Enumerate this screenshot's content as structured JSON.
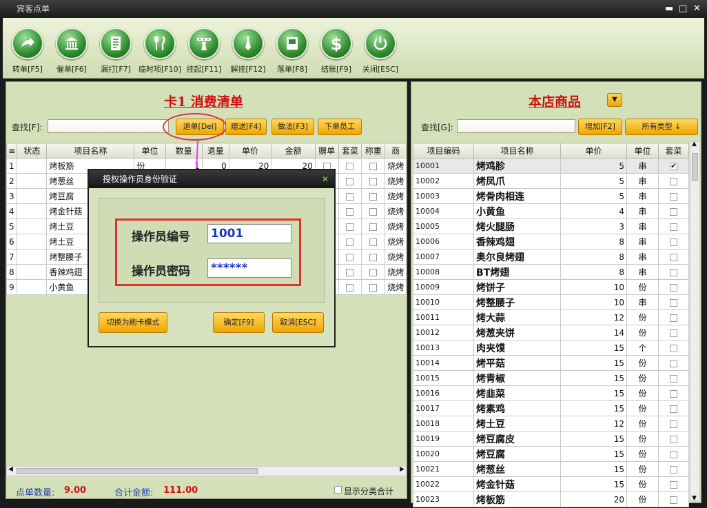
{
  "window": {
    "title": "宾客点单",
    "minimize": "▬",
    "maximize": "□",
    "close": "✕"
  },
  "toolbar": {
    "buttons": [
      {
        "label": "转单[F5]",
        "icon": "arrow-right-icon"
      },
      {
        "label": "催单[F6]",
        "icon": "bank-icon"
      },
      {
        "label": "漏打[F7]",
        "icon": "document-icon"
      },
      {
        "label": "临时项[F10]",
        "icon": "cutlery-icon"
      },
      {
        "label": "挂起[F11]",
        "icon": "waiter-icon"
      },
      {
        "label": "解挂[F12]",
        "icon": "tie-icon"
      },
      {
        "label": "落单[F8]",
        "icon": "book-icon"
      },
      {
        "label": "结账[F9]",
        "icon": "dollar-icon"
      },
      {
        "label": "关闭[ESC]",
        "icon": "power-icon"
      }
    ]
  },
  "left": {
    "title": "卡1  消费清单",
    "find_label": "查找[F]:",
    "find_value": "",
    "buttons": {
      "return": "退单[Del]",
      "gift": "赠送[F4]",
      "method": "做法[F3]",
      "staff": "下单员工"
    },
    "columns": [
      "≡",
      "状态",
      "项目名称",
      "单位",
      "数量",
      "退量",
      "单价",
      "金额",
      "赠单",
      "套菜",
      "称重",
      "商"
    ],
    "rows": [
      {
        "no": "1",
        "status": "",
        "name": "烤板筋",
        "unit": "份",
        "qty": "1",
        "ret": "0",
        "price": "20",
        "amount": "20",
        "cat": "烧烤"
      },
      {
        "no": "2",
        "status": "",
        "name": "烤葱丝",
        "unit": "",
        "qty": "",
        "ret": "",
        "price": "",
        "amount": "",
        "cat": "烧烤"
      },
      {
        "no": "3",
        "status": "",
        "name": "烤豆腐",
        "unit": "",
        "qty": "",
        "ret": "",
        "price": "",
        "amount": "",
        "cat": "烧烤"
      },
      {
        "no": "4",
        "status": "",
        "name": "烤金针菇",
        "unit": "",
        "qty": "",
        "ret": "",
        "price": "",
        "amount": "",
        "cat": "烧烤"
      },
      {
        "no": "5",
        "status": "",
        "name": "烤土豆",
        "unit": "",
        "qty": "",
        "ret": "",
        "price": "",
        "amount": "",
        "cat": "烧烤"
      },
      {
        "no": "6",
        "status": "",
        "name": "烤土豆",
        "unit": "",
        "qty": "",
        "ret": "",
        "price": "",
        "amount": "",
        "cat": "烧烤"
      },
      {
        "no": "7",
        "status": "",
        "name": "烤整腰子",
        "unit": "",
        "qty": "",
        "ret": "",
        "price": "",
        "amount": "",
        "cat": "烧烤"
      },
      {
        "no": "8",
        "status": "",
        "name": "香辣鸡翅",
        "unit": "",
        "qty": "",
        "ret": "",
        "price": "",
        "amount": "",
        "cat": "烧烤"
      },
      {
        "no": "9",
        "status": "",
        "name": "小黄鱼",
        "unit": "",
        "qty": "",
        "ret": "",
        "price": "",
        "amount": "",
        "cat": "烧烤"
      }
    ],
    "footer": {
      "count_label": "点单数量:",
      "count": "9.00",
      "total_label": "合计金额:",
      "total": "111.00",
      "show_cat": "显示分类合计"
    }
  },
  "right": {
    "title": "本店商品",
    "dropdown": "▼",
    "find_label": "查找[G]:",
    "find_value": "",
    "add": "增加[F2]",
    "type": "所有类型 ↓",
    "columns": [
      "项目编码",
      "项目名称",
      "单价",
      "单位",
      "套菜"
    ],
    "rows": [
      {
        "code": "10001",
        "name": "烤鸡胗",
        "price": "5",
        "unit": "串",
        "set": "✔"
      },
      {
        "code": "10002",
        "name": "烤凤爪",
        "price": "5",
        "unit": "串",
        "set": ""
      },
      {
        "code": "10003",
        "name": "烤骨肉相连",
        "price": "5",
        "unit": "串",
        "set": ""
      },
      {
        "code": "10004",
        "name": "小黄鱼",
        "price": "4",
        "unit": "串",
        "set": ""
      },
      {
        "code": "10005",
        "name": "烤火腿肠",
        "price": "3",
        "unit": "串",
        "set": ""
      },
      {
        "code": "10006",
        "name": "香辣鸡翅",
        "price": "8",
        "unit": "串",
        "set": ""
      },
      {
        "code": "10007",
        "name": "奥尔良烤翅",
        "price": "8",
        "unit": "串",
        "set": ""
      },
      {
        "code": "10008",
        "name": "BT烤翅",
        "price": "8",
        "unit": "串",
        "set": ""
      },
      {
        "code": "10009",
        "name": "烤饼子",
        "price": "10",
        "unit": "份",
        "set": ""
      },
      {
        "code": "10010",
        "name": "烤整腰子",
        "price": "10",
        "unit": "串",
        "set": ""
      },
      {
        "code": "10011",
        "name": "烤大蒜",
        "price": "12",
        "unit": "份",
        "set": ""
      },
      {
        "code": "10012",
        "name": "烤葱夹饼",
        "price": "14",
        "unit": "份",
        "set": ""
      },
      {
        "code": "10013",
        "name": "肉夹馍",
        "price": "15",
        "unit": "个",
        "set": ""
      },
      {
        "code": "10014",
        "name": "烤平菇",
        "price": "15",
        "unit": "份",
        "set": ""
      },
      {
        "code": "10015",
        "name": "烤青椒",
        "price": "15",
        "unit": "份",
        "set": ""
      },
      {
        "code": "10016",
        "name": "烤韭菜",
        "price": "15",
        "unit": "份",
        "set": ""
      },
      {
        "code": "10017",
        "name": "烤素鸡",
        "price": "15",
        "unit": "份",
        "set": ""
      },
      {
        "code": "10018",
        "name": "烤土豆",
        "price": "12",
        "unit": "份",
        "set": ""
      },
      {
        "code": "10019",
        "name": "烤豆腐皮",
        "price": "15",
        "unit": "份",
        "set": ""
      },
      {
        "code": "10020",
        "name": "烤豆腐",
        "price": "15",
        "unit": "份",
        "set": ""
      },
      {
        "code": "10021",
        "name": "烤葱丝",
        "price": "15",
        "unit": "份",
        "set": ""
      },
      {
        "code": "10022",
        "name": "烤金针菇",
        "price": "15",
        "unit": "份",
        "set": ""
      },
      {
        "code": "10023",
        "name": "烤板筋",
        "price": "20",
        "unit": "份",
        "set": ""
      }
    ]
  },
  "dialog": {
    "title": "授权操作员身份验证",
    "close": "✕",
    "id_label": "操作员编号",
    "id_value": "1001",
    "pwd_label": "操作员密码",
    "pwd_value": "******",
    "switch": "切换为刷卡模式",
    "ok": "确定[F9]",
    "cancel": "取消[ESC]"
  }
}
